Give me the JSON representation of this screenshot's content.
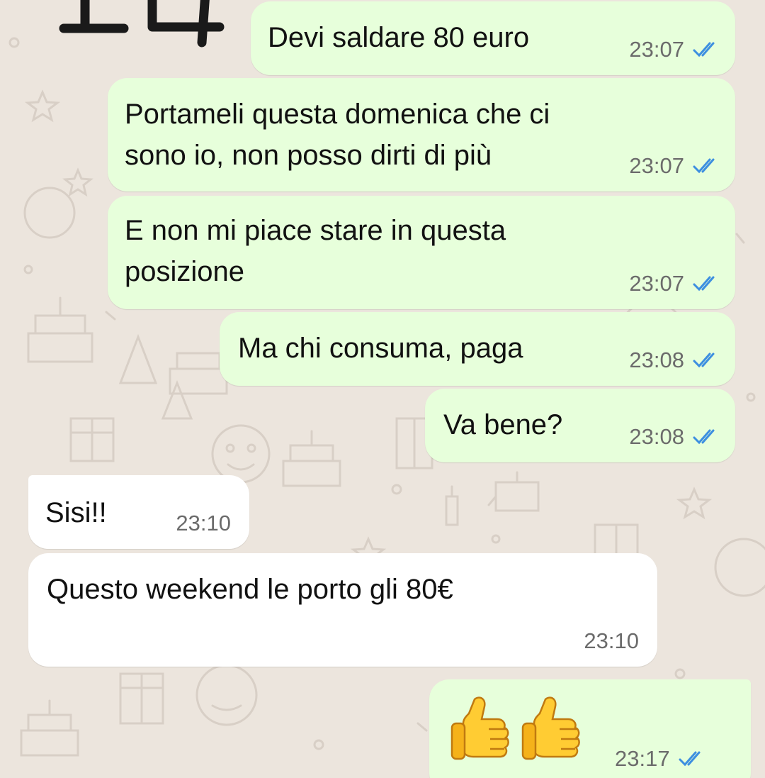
{
  "handwriting": "14",
  "colors": {
    "outgoing_bubble": "#e7ffdb",
    "incoming_bubble": "#ffffff",
    "read_ticks": "#3d8fe0",
    "background": "#ece5dd"
  },
  "messages": [
    {
      "direction": "outgoing",
      "text": "Devi saldare 80 euro",
      "time": "23:07",
      "status": "read"
    },
    {
      "direction": "outgoing",
      "text": "Portameli questa domenica che ci\nsono io, non posso dirti di più",
      "time": "23:07",
      "status": "read"
    },
    {
      "direction": "outgoing",
      "text": "E non mi piace stare in questa\nposizione",
      "time": "23:07",
      "status": "read"
    },
    {
      "direction": "outgoing",
      "text": "Ma chi consuma, paga",
      "time": "23:08",
      "status": "read"
    },
    {
      "direction": "outgoing",
      "text": "Va bene?",
      "time": "23:08",
      "status": "read"
    },
    {
      "direction": "incoming",
      "text": "Sisi!!",
      "time": "23:10"
    },
    {
      "direction": "incoming",
      "text": "Questo weekend le porto gli 80€",
      "time": "23:10"
    },
    {
      "direction": "outgoing",
      "emoji": "thumbs-up thumbs-up",
      "time": "23:17",
      "status": "read"
    }
  ]
}
